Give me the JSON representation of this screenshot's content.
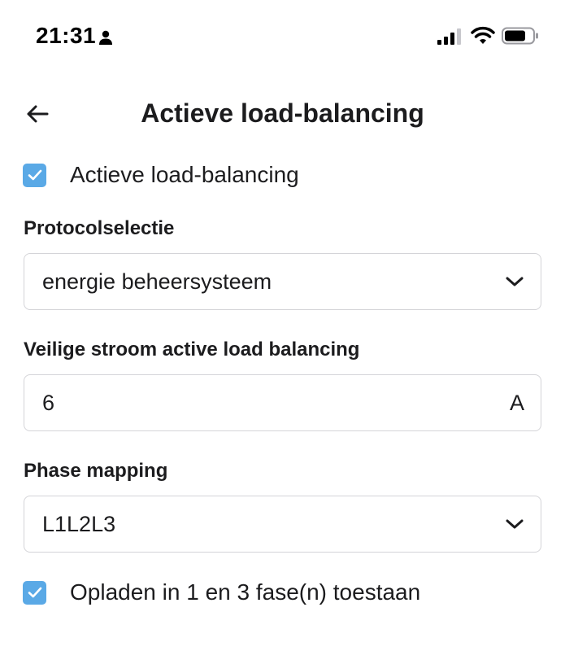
{
  "status_bar": {
    "time": "21:31",
    "icons": [
      "person-icon",
      "signal-icon",
      "wifi-icon",
      "battery-icon"
    ]
  },
  "header": {
    "back_icon": "arrow-left-icon",
    "title": "Actieve load-balancing"
  },
  "active_lb_checkbox": {
    "label": "Actieve load-balancing",
    "checked": true
  },
  "protocol": {
    "label": "Protocolselectie",
    "value": "energie beheersysteem"
  },
  "safe_current": {
    "label": "Veilige stroom active load balancing",
    "value": "6",
    "unit": "A"
  },
  "phase_mapping": {
    "label": "Phase mapping",
    "value": "L1L2L3"
  },
  "phase_checkbox": {
    "label": "Opladen in 1 en 3 fase(n) toestaan",
    "checked": true
  },
  "colors": {
    "accent": "#5aa9e6",
    "text": "#1c1c1e",
    "border": "#d4d4d8"
  }
}
